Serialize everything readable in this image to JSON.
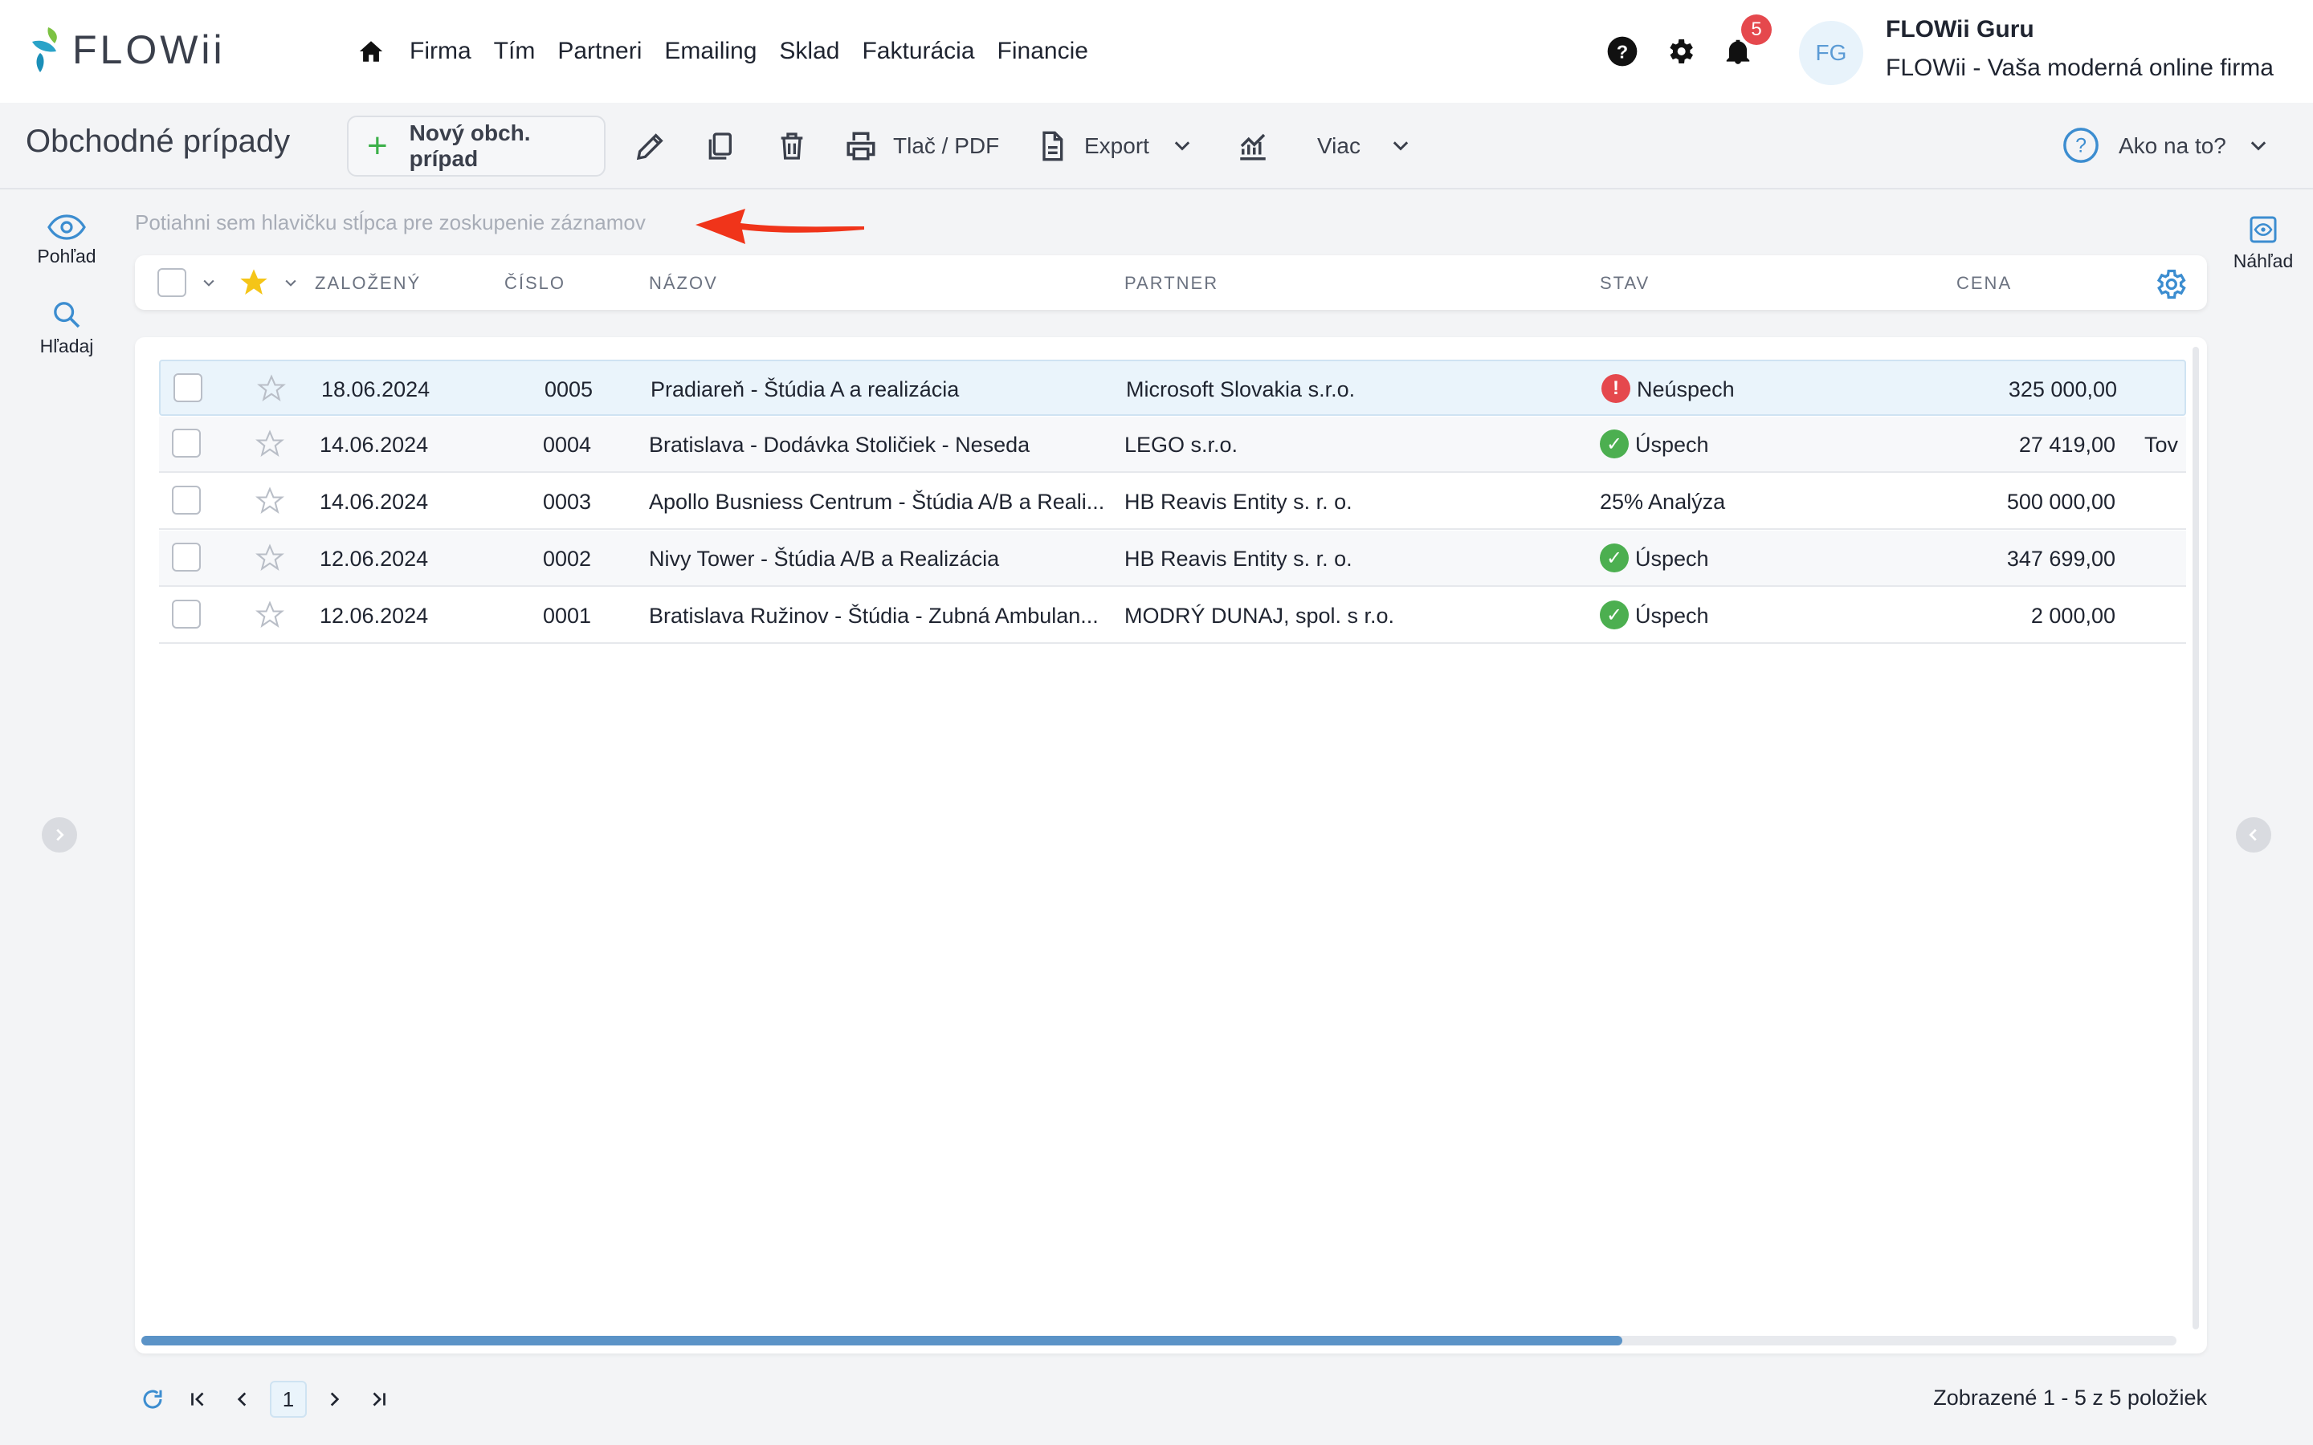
{
  "app": {
    "logo_text": "FLOWii",
    "nav": [
      "Firma",
      "Tím",
      "Partneri",
      "Emailing",
      "Sklad",
      "Fakturácia",
      "Financie"
    ],
    "notifications_count": "5",
    "avatar_initials": "FG",
    "user_name": "FLOWii Guru",
    "user_company": "FLOWii - Vaša moderná online firma"
  },
  "toolbar": {
    "title": "Obchodné prípady",
    "new_label": "Nový obch. prípad",
    "print_label": "Tlač / PDF",
    "export_label": "Export",
    "more_label": "Viac",
    "help_label": "Ako na to?"
  },
  "sidebar": {
    "view_label": "Pohľad",
    "search_label": "Hľadaj",
    "preview_label": "Náhľad"
  },
  "grid": {
    "group_hint": "Potiahni sem hlavičku stĺpca pre zoskupenie záznamov",
    "columns": [
      "ZALOŽENÝ",
      "ČÍSLO",
      "NÁZOV",
      "PARTNER",
      "STAV",
      "CENA"
    ],
    "rows": [
      {
        "date": "18.06.2024",
        "number": "0005",
        "name": "Pradiareň - Štúdia A a realizácia",
        "partner": "Microsoft Slovakia s.r.o.",
        "status": "Neúspech",
        "status_type": "fail",
        "price": "325 000,00",
        "extra": ""
      },
      {
        "date": "14.06.2024",
        "number": "0004",
        "name": "Bratislava - Dodávka Stoličiek - Neseda",
        "partner": "LEGO s.r.o.",
        "status": "Úspech",
        "status_type": "ok",
        "price": "27 419,00",
        "extra": "Tov"
      },
      {
        "date": "14.06.2024",
        "number": "0003",
        "name": "Apollo Busniess Centrum - Štúdia A/B a Reali...",
        "partner": "HB Reavis Entity s. r. o.",
        "status": "25% Analýza",
        "status_type": "none",
        "price": "500 000,00",
        "extra": ""
      },
      {
        "date": "12.06.2024",
        "number": "0002",
        "name": "Nivy Tower - Štúdia A/B a Realizácia",
        "partner": "HB Reavis Entity s. r. o.",
        "status": "Úspech",
        "status_type": "ok",
        "price": "347 699,00",
        "extra": ""
      },
      {
        "date": "12.06.2024",
        "number": "0001",
        "name": "Bratislava Ružinov - Štúdia - Zubná Ambulan...",
        "partner": "MODRÝ DUNAJ, spol. s r.o.",
        "status": "Úspech",
        "status_type": "ok",
        "price": "2 000,00",
        "extra": ""
      }
    ],
    "status_colors": {
      "ok": "#4caf50",
      "fail": "#e5484d"
    }
  },
  "pager": {
    "current_page": "1",
    "info": "Zobrazené 1 - 5 z 5 položiek"
  }
}
